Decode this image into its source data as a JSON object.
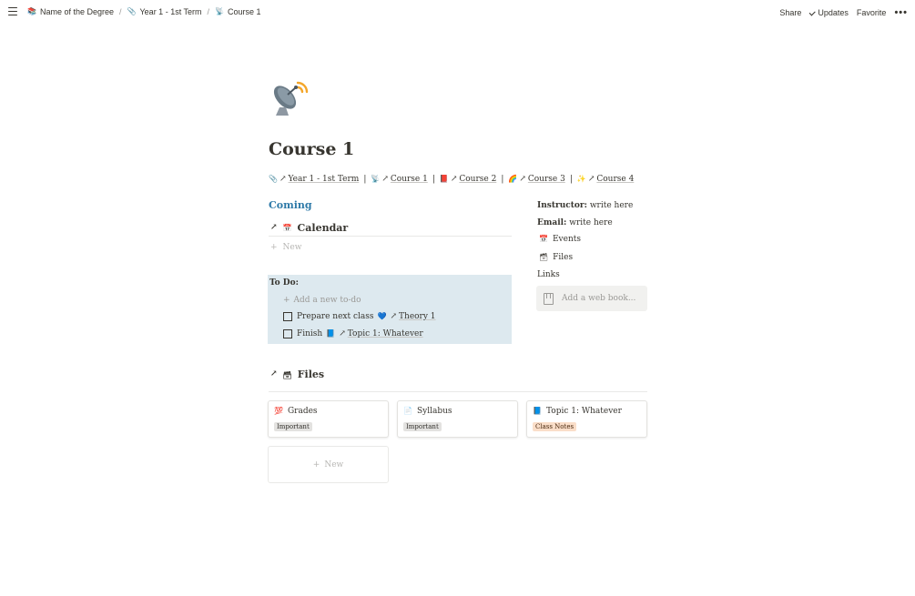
{
  "breadcrumb": [
    {
      "icon": "books-emoji-icon",
      "glyph": "📚",
      "label": "Name of the Degree"
    },
    {
      "icon": "paperclip-icon",
      "glyph": "📎",
      "label": "Year 1 - 1st Term"
    },
    {
      "icon": "satellite-dish-icon",
      "glyph": "📡",
      "label": "Course 1"
    }
  ],
  "breadcrumb_separator": "/",
  "top_actions": {
    "share": "Share",
    "updates": "Updates",
    "favorite": "Favorite",
    "more": "•••"
  },
  "page": {
    "icon": "satellite-dish-icon",
    "title": "Course 1"
  },
  "courses_line": {
    "term": "Year 1 - 1st Term",
    "course1": "Course 1",
    "course2": "Course 2",
    "course3": "Course 3",
    "course4": "Course 4",
    "pipe": "|"
  },
  "coming": {
    "heading": "Coming",
    "calendar_title": "Calendar",
    "new_label": "New"
  },
  "todo": {
    "label": "To Do:",
    "add_label": "Add a new to-do",
    "items": [
      {
        "text": "Prepare next class",
        "mention": "Theory 1",
        "checked": false
      },
      {
        "text": "Finish",
        "mention": "Topic 1: Whatever",
        "checked": false
      }
    ]
  },
  "sidebar_info": {
    "instructor_label": "Instructor:",
    "instructor_value": "write here",
    "email_label": "Email:",
    "email_value": "write here",
    "events_link": "Events",
    "files_link": "Files",
    "links_label": "Links",
    "bookmark_placeholder": "Add a web book..."
  },
  "files": {
    "heading": "Files",
    "cards": [
      {
        "icon": "grades-emoji-icon",
        "title": "Grades",
        "tag": "Important",
        "tag_color": "#e3e2e0"
      },
      {
        "icon": "document-emoji-icon",
        "title": "Syllabus",
        "tag": "Important",
        "tag_color": "#e3e2e0"
      },
      {
        "icon": "blue-book-emoji-icon",
        "title": "Topic 1: Whatever",
        "tag": "Class Notes",
        "tag_color": "#fadec9"
      }
    ],
    "new_label": "New"
  },
  "colors": {
    "accent_heading": "#2e7aa8",
    "todo_background": "#dde9ef",
    "bookmark_background": "#f1f1ef"
  }
}
